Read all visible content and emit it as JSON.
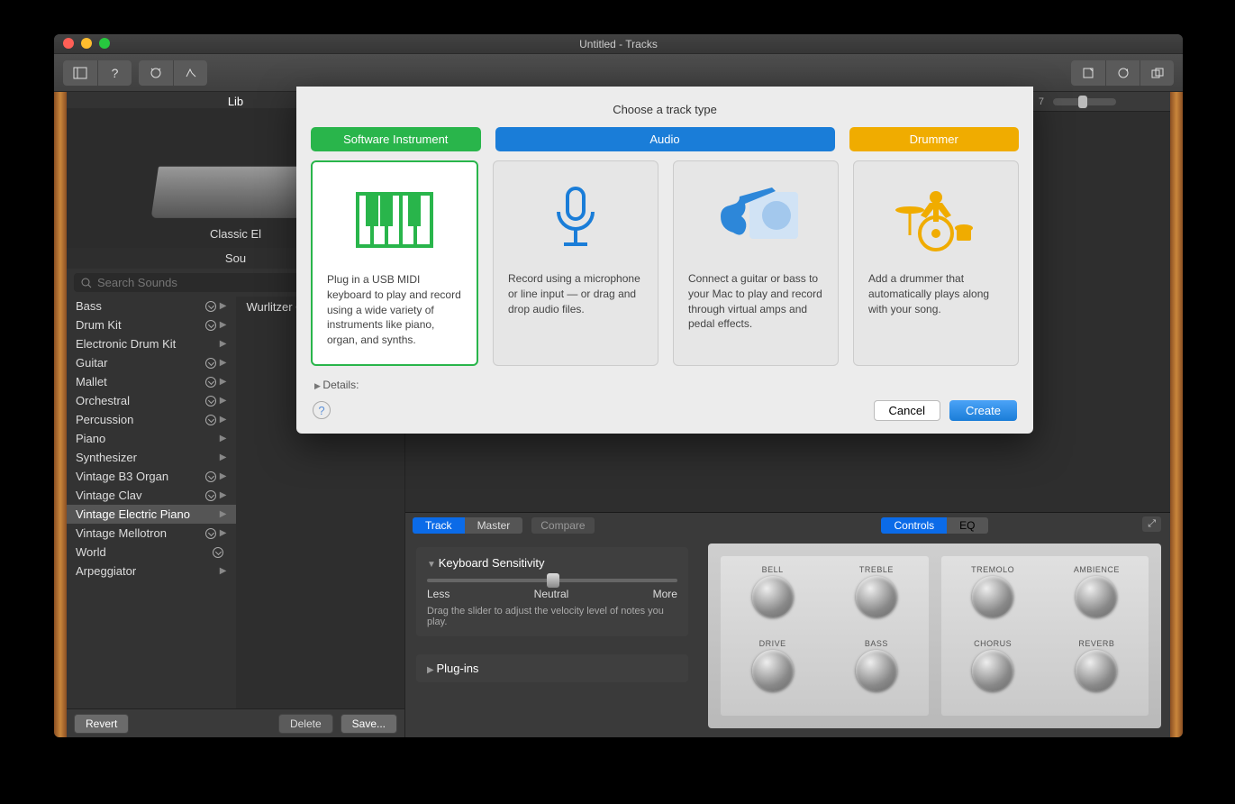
{
  "window_title": "Untitled - Tracks",
  "library": {
    "title_truncated": "Lib",
    "instrument_name": "Classic El",
    "tabs_truncated": "Sou",
    "search_placeholder": "Search Sounds",
    "categories": [
      {
        "name": "Bass",
        "dl": true,
        "arrow": true
      },
      {
        "name": "Drum Kit",
        "dl": true,
        "arrow": true
      },
      {
        "name": "Electronic Drum Kit",
        "dl": false,
        "arrow": true
      },
      {
        "name": "Guitar",
        "dl": true,
        "arrow": true
      },
      {
        "name": "Mallet",
        "dl": true,
        "arrow": true
      },
      {
        "name": "Orchestral",
        "dl": true,
        "arrow": true
      },
      {
        "name": "Percussion",
        "dl": true,
        "arrow": true
      },
      {
        "name": "Piano",
        "dl": false,
        "arrow": true
      },
      {
        "name": "Synthesizer",
        "dl": false,
        "arrow": true
      },
      {
        "name": "Vintage B3 Organ",
        "dl": true,
        "arrow": true
      },
      {
        "name": "Vintage Clav",
        "dl": true,
        "arrow": true
      },
      {
        "name": "Vintage Electric Piano",
        "dl": false,
        "arrow": true,
        "sel": true
      },
      {
        "name": "Vintage Mellotron",
        "dl": true,
        "arrow": true
      },
      {
        "name": "World",
        "dl": true,
        "arrow": false
      },
      {
        "name": "Arpeggiator",
        "dl": false,
        "arrow": true
      }
    ],
    "sub_item": "Wurlitzer Classic",
    "revert": "Revert",
    "delete": "Delete",
    "save": "Save..."
  },
  "ruler_mark": "7",
  "bottom": {
    "track_tab": "Track",
    "master_tab": "Master",
    "compare": "Compare",
    "controls_tab": "Controls",
    "eq_tab": "EQ",
    "ks_title": "Keyboard Sensitivity",
    "ks_less": "Less",
    "ks_neutral": "Neutral",
    "ks_more": "More",
    "ks_desc": "Drag the slider to adjust the velocity level of notes you play.",
    "plugins_title": "Plug-ins",
    "knobs_left": [
      "BELL",
      "TREBLE",
      "DRIVE",
      "BASS"
    ],
    "knobs_right": [
      "TREMOLO",
      "AMBIENCE",
      "CHORUS",
      "REVERB"
    ]
  },
  "dialog": {
    "title": "Choose a track type",
    "headers": {
      "si": "Software Instrument",
      "audio": "Audio",
      "drummer": "Drummer"
    },
    "opt_si": "Plug in a USB MIDI keyboard to play and record using a wide variety of instruments like piano, organ, and synths.",
    "opt_mic": "Record using a microphone or line input — or drag and drop audio files.",
    "opt_guitar": "Connect a guitar or bass to your Mac to play and record through virtual amps and pedal effects.",
    "opt_drummer": "Add a drummer that automatically plays along with your song.",
    "details": "Details:",
    "cancel": "Cancel",
    "create": "Create"
  }
}
